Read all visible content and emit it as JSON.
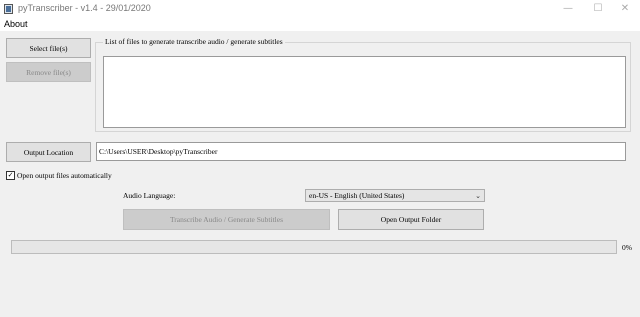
{
  "window": {
    "title": "pyTranscriber - v1.4 - 29/01/2020",
    "minimize_glyph": "—",
    "maximize_glyph": "☐",
    "close_glyph": "✕"
  },
  "menu": {
    "about": "About"
  },
  "buttons": {
    "select_files": "Select file(s)",
    "remove_files": "Remove file(s)",
    "output_location": "Output Location",
    "transcribe": "Transcribe Audio / Generate Subtitles",
    "open_output_folder": "Open Output Folder"
  },
  "files_group": {
    "title": "List of files to generate transcribe audio / generate subtitles",
    "items": []
  },
  "output_path": "C:\\Users\\USER\\Desktop\\pyTranscriber",
  "open_after": {
    "label": "Open output files automatically",
    "checked": true,
    "mark": "✓"
  },
  "language": {
    "label": "Audio Language:",
    "selected": "en-US - English (United States)",
    "chevron": "⌄"
  },
  "progress": {
    "value": 0,
    "text": "0%",
    "color": "#06b025"
  },
  "icons": {
    "app": "app-icon",
    "checkbox": "checkmark-icon",
    "dropdown": "chevron-down-icon"
  }
}
